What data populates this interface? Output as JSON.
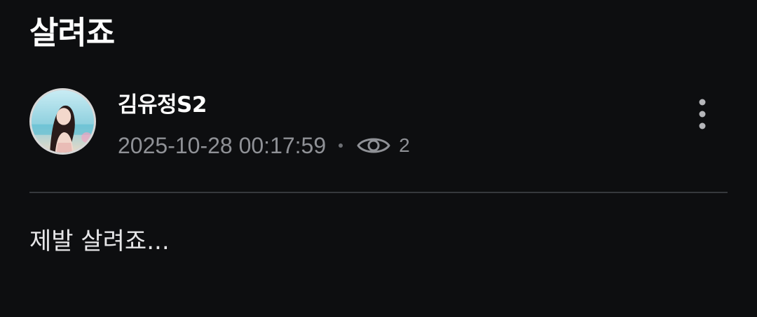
{
  "post": {
    "title": "살려죠",
    "body": "제발 살려죠..."
  },
  "author": {
    "name": "김유정S2",
    "avatar": "profile-photo"
  },
  "meta": {
    "timestamp": "2025-10-28 00:17:59",
    "separator": "•",
    "views": "2",
    "views_icon": "eye-icon"
  },
  "actions": {
    "more_icon": "vertical-ellipsis-icon"
  },
  "colors": {
    "background": "#0d0e10",
    "title_text": "#ffffff",
    "meta_text": "#8f9196",
    "divider": "#36383c",
    "body_text": "#e6e6e8"
  }
}
